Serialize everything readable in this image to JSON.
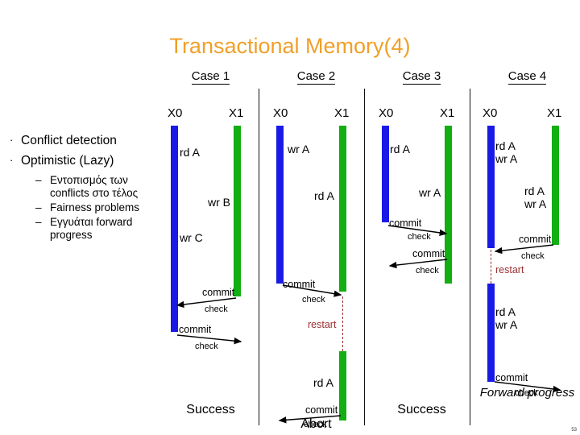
{
  "slide": {
    "title": "Transactional Memory(4)",
    "title_color": "#F0A028",
    "page_number": "53"
  },
  "bullets": {
    "level1": [
      {
        "marker": "·",
        "text": "Conflict detection"
      },
      {
        "marker": "·",
        "text": "Optimistic (Lazy)"
      }
    ],
    "level2": [
      {
        "marker": "–",
        "text": "Εντοπισμός των conflicts στο τέλος"
      },
      {
        "marker": "–",
        "text": "Fairness problems"
      },
      {
        "marker": "–",
        "text": "Εγγυάται forward progress"
      }
    ]
  },
  "diagram": {
    "colors": {
      "x0_bar": "#1A1AE6",
      "x1_bar": "#12AE12",
      "restart": "#9B3030"
    },
    "labels": {
      "x0": "X0",
      "x1": "X1",
      "commit": "commit",
      "check": "check",
      "restart": "restart"
    },
    "cases": [
      {
        "title": "Case 1",
        "x0_label": "X0",
        "x1_label": "X1",
        "x0_ops": [
          "rd A",
          "wr C"
        ],
        "x1_ops": [
          "wr B"
        ],
        "x0_commit": "commit",
        "x0_check": "check",
        "x1_commit": "commit",
        "x1_check": "check",
        "restart": "",
        "outcome": "Success"
      },
      {
        "title": "Case 2",
        "x0_label": "X0",
        "x1_label": "X1",
        "x0_ops": [
          "wr A"
        ],
        "x1_ops": [
          "rd A"
        ],
        "x1_ops_retry": [
          "rd A"
        ],
        "x0_commit": "commit",
        "x0_check": "check",
        "x1_commit": "commit",
        "x1_check": "check",
        "restart": "restart",
        "outcome": "Abort"
      },
      {
        "title": "Case 3",
        "x0_label": "X0",
        "x1_label": "X1",
        "x0_ops": [
          "rd A"
        ],
        "x1_ops": [
          "wr A"
        ],
        "x0_commit": "commit",
        "x0_check": "check",
        "x1_commit": "commit",
        "x1_check": "check",
        "restart": "",
        "outcome": "Success"
      },
      {
        "title": "Case 4",
        "x0_label": "X0",
        "x1_label": "X1",
        "x0_ops": [
          "rd A",
          "wr A"
        ],
        "x0_ops_retry": [
          "rd A",
          "wr A"
        ],
        "x1_ops": [
          "rd A",
          "wr A"
        ],
        "x0_commit": "commit",
        "x0_check": "check",
        "x1_commit": "commit",
        "x1_check": "check",
        "restart": "restart",
        "outcome": "Forward progress"
      }
    ]
  }
}
